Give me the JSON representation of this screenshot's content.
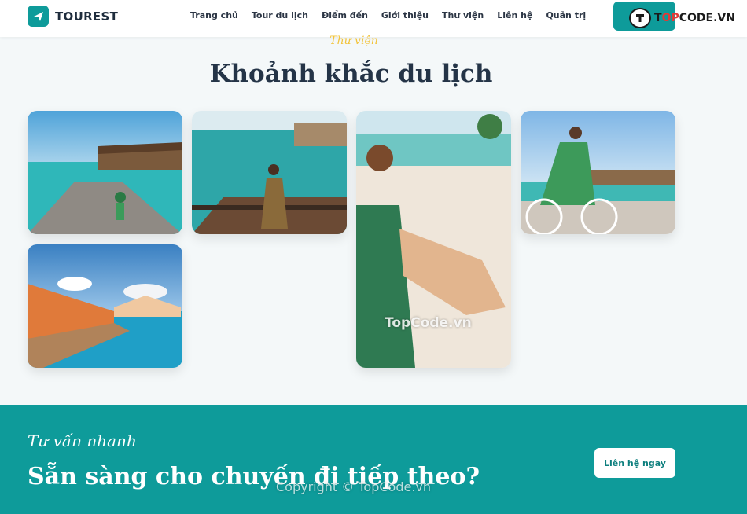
{
  "header": {
    "brand": "TOUREST",
    "nav": [
      "Trang chủ",
      "Tour du lịch",
      "Điểm đến",
      "Giới thiệu",
      "Thư viện",
      "Liên hệ",
      "Quản trị"
    ],
    "watermark_prefix": "T",
    "watermark_accent": "OP",
    "watermark_suffix": "CODE.VN"
  },
  "gallery": {
    "eyebrow": "Thư viện",
    "title": "Khoảnh khắc du lịch",
    "photos": [
      {
        "subject": "woman-cycling-boardwalk-photo"
      },
      {
        "subject": "woman-sitting-water-villa-photo"
      },
      {
        "subject": "woman-sitting-beach-photo"
      },
      {
        "subject": "woman-on-bicycle-photo"
      },
      {
        "subject": "overwater-bungalows-photo"
      }
    ],
    "watermark": "TopCode.vn"
  },
  "cta": {
    "eyebrow": "Tư vấn nhanh",
    "title": "Sẵn sàng cho chuyến đi tiếp theo?",
    "button": "Liên hệ ngay",
    "copyright": "Copyright © TopCode.vn"
  },
  "colors": {
    "accent": "#0e9b9a",
    "eyebrow": "#f2c43d",
    "heading": "#243447"
  }
}
